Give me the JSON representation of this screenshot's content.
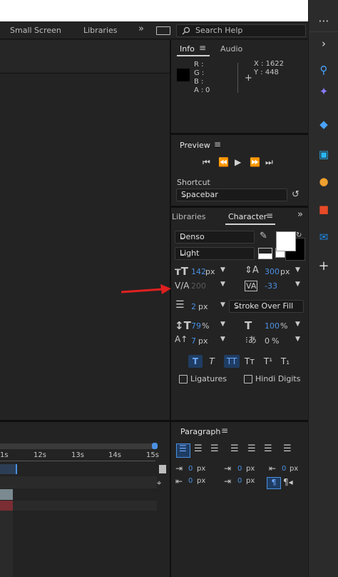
{
  "toolbar": {
    "workspaces": [
      "Small Screen",
      "Libraries"
    ],
    "more": "»",
    "search_placeholder": "Search Help"
  },
  "info": {
    "tabs": [
      "Info",
      "Audio"
    ],
    "rgba": [
      {
        "label": "R :",
        "value": ""
      },
      {
        "label": "G :",
        "value": ""
      },
      {
        "label": "B :",
        "value": ""
      },
      {
        "label": "A :",
        "value": "0"
      }
    ],
    "x": "X : 1622",
    "y": "Y : 448"
  },
  "preview": {
    "title": "Preview",
    "shortcut_label": "Shortcut",
    "shortcut_value": "Spacebar"
  },
  "character": {
    "tabs": [
      "Libraries",
      "Character"
    ],
    "font_family": "Denso",
    "font_style": "Light",
    "font_size": "142",
    "font_size_unit": "px",
    "leading": "300",
    "leading_unit": "px",
    "kerning": "200",
    "tracking": "-33",
    "stroke_width": "2",
    "stroke_unit": "px",
    "stroke_mode": "Stroke Over Fill",
    "vert_scale": "79",
    "vert_unit": "%",
    "horiz_scale": "100",
    "horiz_unit": "%",
    "baseline": "7",
    "baseline_unit": "px",
    "tsume": "0",
    "tsume_unit": "%",
    "style_buttons": [
      "T",
      "T",
      "TT",
      "Tт",
      "T¹",
      "T₁"
    ],
    "ligatures": "Ligatures",
    "hindi_digits": "Hindi Digits"
  },
  "paragraph": {
    "title": "Paragraph",
    "indents": [
      {
        "value": "0",
        "unit": "px"
      },
      {
        "value": "0",
        "unit": "px"
      },
      {
        "value": "0",
        "unit": "px"
      },
      {
        "value": "0",
        "unit": "px"
      },
      {
        "value": "0",
        "unit": "px"
      }
    ]
  },
  "timeline": {
    "ticks": [
      "1s",
      "12s",
      "13s",
      "14s",
      "15s"
    ]
  },
  "colors": {
    "accent": "#4a90e2",
    "arrow": "#e02020"
  }
}
